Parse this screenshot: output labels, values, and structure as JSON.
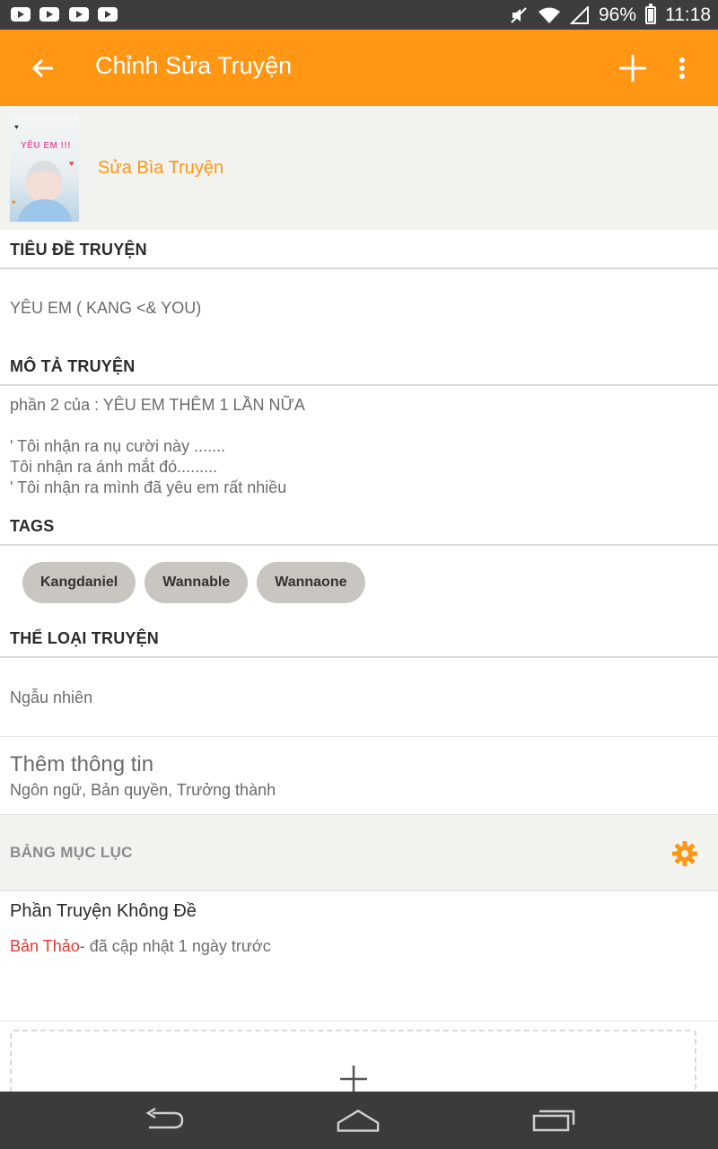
{
  "status_bar": {
    "battery": "96%",
    "time": "11:18",
    "notification_icons": [
      "youtube-icon",
      "youtube-icon",
      "youtube-icon",
      "youtube-icon"
    ]
  },
  "app_bar": {
    "title": "Chỉnh Sửa Truyện",
    "color": "#ff9614"
  },
  "cover": {
    "image_text": "YÊU EM !!!",
    "edit_label": "Sửa Bìa Truyện"
  },
  "title_section": {
    "label": "TIÊU ĐỀ TRUYỆN",
    "value": "YÊU EM ( KANG <& YOU)"
  },
  "description_section": {
    "label": "MÔ TẢ TRUYỆN",
    "value": "phần 2 của : YÊU EM THÊM 1 LẦN NỮA\n\n' Tôi nhận ra nụ cười này .......\nTôi nhận ra ánh mắt đó.........\n' Tôi nhận ra mình đã yêu em rất nhiều"
  },
  "tags_section": {
    "label": "TAGS",
    "tags": [
      "Kangdaniel",
      "Wannable",
      "Wannaone"
    ]
  },
  "genre_section": {
    "label": "THỂ LOẠI TRUYỆN",
    "value": "Ngẫu nhiên"
  },
  "more_info": {
    "title": "Thêm thông tin",
    "subtitle": "Ngôn ngữ, Bản quyền, Trưởng thành"
  },
  "toc": {
    "label": "BẢNG MỤC LỤC",
    "parts": [
      {
        "title": "Phần Truyện Không Đề",
        "status": "Bản Thảo",
        "updated": "- đã cập nhật 1 ngày trước"
      }
    ]
  },
  "colors": {
    "accent": "#ff9614",
    "draft": "#e53935"
  }
}
